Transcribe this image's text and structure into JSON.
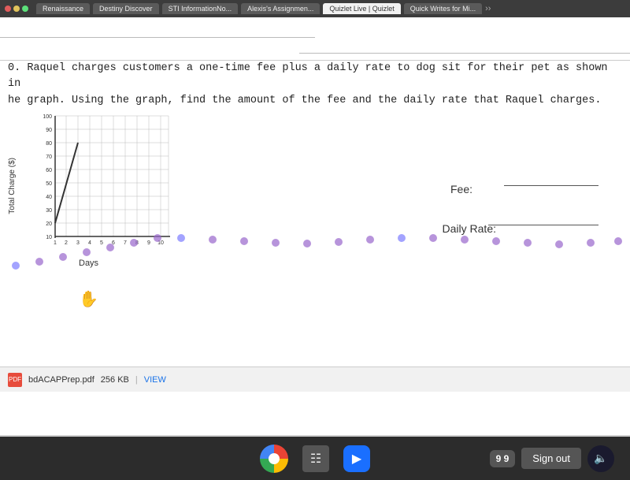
{
  "tabs": [
    {
      "label": "Renaissance",
      "active": false
    },
    {
      "label": "Destiny Discover",
      "active": false
    },
    {
      "label": "STI InformationNo...",
      "active": false
    },
    {
      "label": "Alexis's Assignmen...",
      "active": false
    },
    {
      "label": "Quizlet Live | Quizlet",
      "active": false
    },
    {
      "label": "Quick Writes for Mi...",
      "active": false
    }
  ],
  "problem": {
    "number": "0.",
    "text": "Raquel charges customers a one-time fee plus a daily rate to dog sit for their pet as shown in",
    "text2": "he graph. Using the graph, find the amount of the fee and the daily rate that Raquel charges."
  },
  "graph": {
    "y_label": "Total Charge ($)",
    "x_label": "Days",
    "y_ticks": [
      "100",
      "90",
      "80",
      "70",
      "60",
      "50",
      "40",
      "30",
      "20",
      "10"
    ],
    "x_ticks": [
      "1",
      "2",
      "3",
      "4",
      "5",
      "6",
      "7",
      "8",
      "9",
      "10"
    ]
  },
  "fields": {
    "fee_label": "Fee:",
    "rate_label": "Daily Rate:"
  },
  "download": {
    "filename": "bdACAPPrep.pdf",
    "size": "256 KB",
    "view_label": "VIEW"
  },
  "taskbar": {
    "counter": "9 9",
    "signout_label": "Sign out"
  }
}
